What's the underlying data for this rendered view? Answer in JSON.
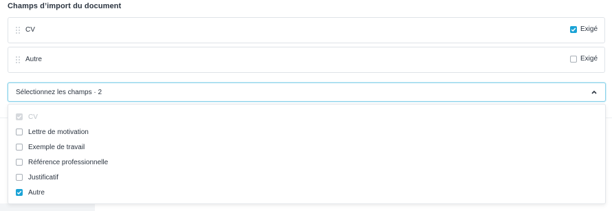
{
  "section": {
    "title": "Champs d’import du document"
  },
  "fields": [
    {
      "label": "CV",
      "required_label": "Exigé",
      "required_checked": true
    },
    {
      "label": "Autre",
      "required_label": "Exigé",
      "required_checked": false
    }
  ],
  "select": {
    "label": "Sélectionnez les champs · 2",
    "icon": "chevron-up-icon"
  },
  "options": [
    {
      "label": "CV",
      "checked": true,
      "disabled": true
    },
    {
      "label": "Lettre de motivation",
      "checked": false,
      "disabled": false
    },
    {
      "label": "Exemple de travail",
      "checked": false,
      "disabled": false
    },
    {
      "label": "Référence professionnelle",
      "checked": false,
      "disabled": false
    },
    {
      "label": "Justificatif",
      "checked": false,
      "disabled": false
    },
    {
      "label": "Autre",
      "checked": true,
      "disabled": false
    }
  ],
  "colors": {
    "accent": "#1ba3d6",
    "focus_border": "#8cd3ea",
    "text": "#2b3440",
    "disabled_text": "#c0c5cb"
  }
}
